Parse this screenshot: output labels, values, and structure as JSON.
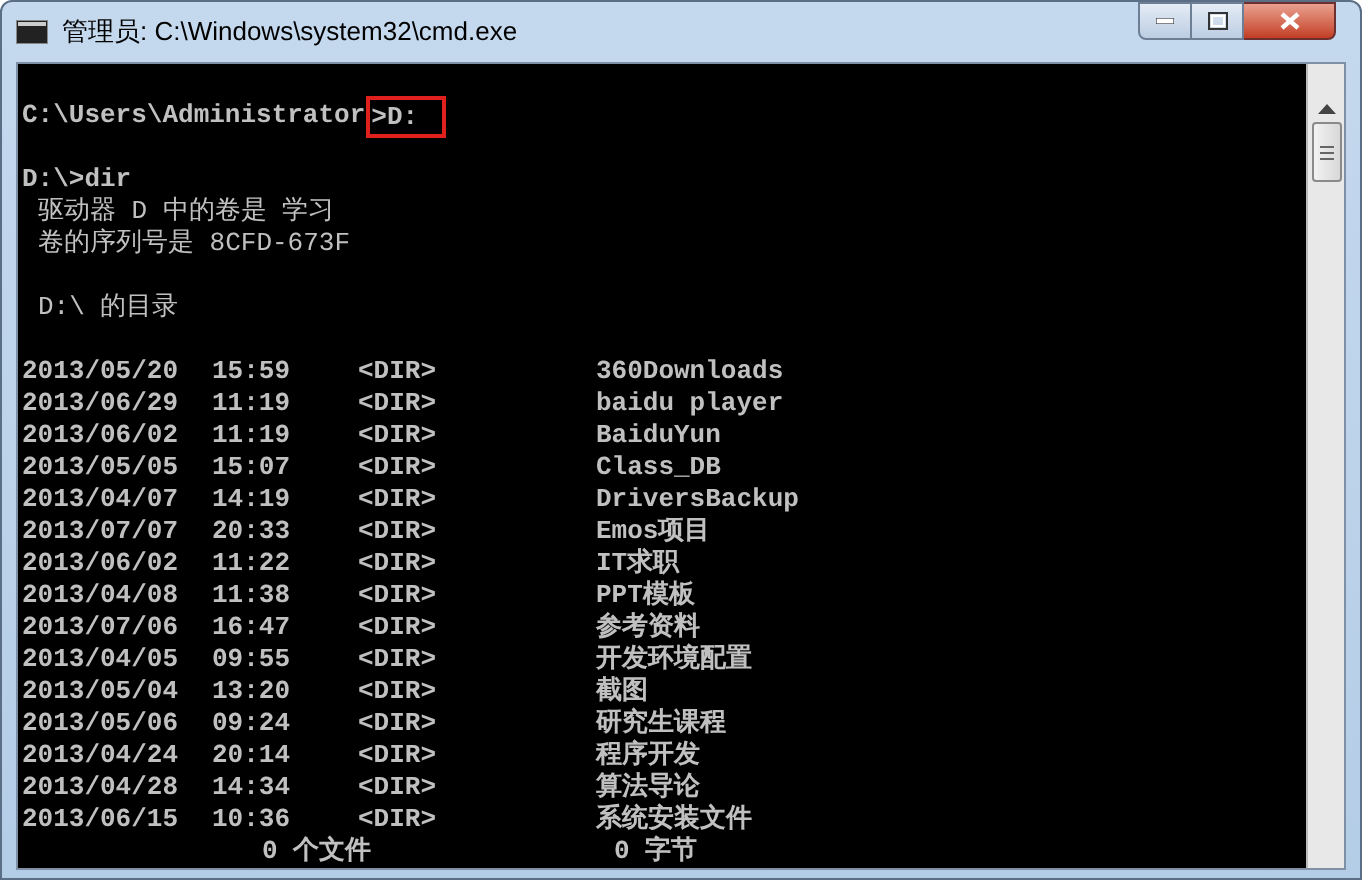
{
  "window": {
    "title": "管理员: C:\\Windows\\system32\\cmd.exe"
  },
  "console": {
    "lines": [
      {
        "kind": "blank"
      },
      {
        "kind": "prompt",
        "path": "C:\\Users\\Administrator",
        "command": ">D:",
        "highlighted": true
      },
      {
        "kind": "blank"
      },
      {
        "kind": "command",
        "text": "D:\\>dir"
      },
      {
        "kind": "info",
        "text": "驱动器 D 中的卷是 学习"
      },
      {
        "kind": "info",
        "text": "卷的序列号是 8CFD-673F"
      },
      {
        "kind": "blank"
      },
      {
        "kind": "info",
        "text": "D:\\ 的目录"
      },
      {
        "kind": "blank"
      },
      {
        "kind": "dir_row",
        "date": "2013/05/20",
        "time": "15:59",
        "type": "<DIR>",
        "name": "360Downloads"
      },
      {
        "kind": "dir_row",
        "date": "2013/06/29",
        "time": "11:19",
        "type": "<DIR>",
        "name": "baidu player"
      },
      {
        "kind": "dir_row",
        "date": "2013/06/02",
        "time": "11:19",
        "type": "<DIR>",
        "name": "BaiduYun"
      },
      {
        "kind": "dir_row",
        "date": "2013/05/05",
        "time": "15:07",
        "type": "<DIR>",
        "name": "Class_DB"
      },
      {
        "kind": "dir_row",
        "date": "2013/04/07",
        "time": "14:19",
        "type": "<DIR>",
        "name": "DriversBackup"
      },
      {
        "kind": "dir_row",
        "date": "2013/07/07",
        "time": "20:33",
        "type": "<DIR>",
        "name": "Emos项目"
      },
      {
        "kind": "dir_row",
        "date": "2013/06/02",
        "time": "11:22",
        "type": "<DIR>",
        "name": "IT求职"
      },
      {
        "kind": "dir_row",
        "date": "2013/04/08",
        "time": "11:38",
        "type": "<DIR>",
        "name": "PPT模板"
      },
      {
        "kind": "dir_row",
        "date": "2013/07/06",
        "time": "16:47",
        "type": "<DIR>",
        "name": "参考资料"
      },
      {
        "kind": "dir_row",
        "date": "2013/04/05",
        "time": "09:55",
        "type": "<DIR>",
        "name": "开发环境配置"
      },
      {
        "kind": "dir_row",
        "date": "2013/05/04",
        "time": "13:20",
        "type": "<DIR>",
        "name": "截图"
      },
      {
        "kind": "dir_row",
        "date": "2013/05/06",
        "time": "09:24",
        "type": "<DIR>",
        "name": "研究生课程"
      },
      {
        "kind": "dir_row",
        "date": "2013/04/24",
        "time": "20:14",
        "type": "<DIR>",
        "name": "程序开发"
      },
      {
        "kind": "dir_row",
        "date": "2013/04/28",
        "time": "14:34",
        "type": "<DIR>",
        "name": "算法导论"
      },
      {
        "kind": "dir_row",
        "date": "2013/06/15",
        "time": "10:36",
        "type": "<DIR>",
        "name": "系统安装文件"
      },
      {
        "kind": "summary",
        "files": "0 个文件",
        "bytes": "0 字节"
      }
    ]
  }
}
